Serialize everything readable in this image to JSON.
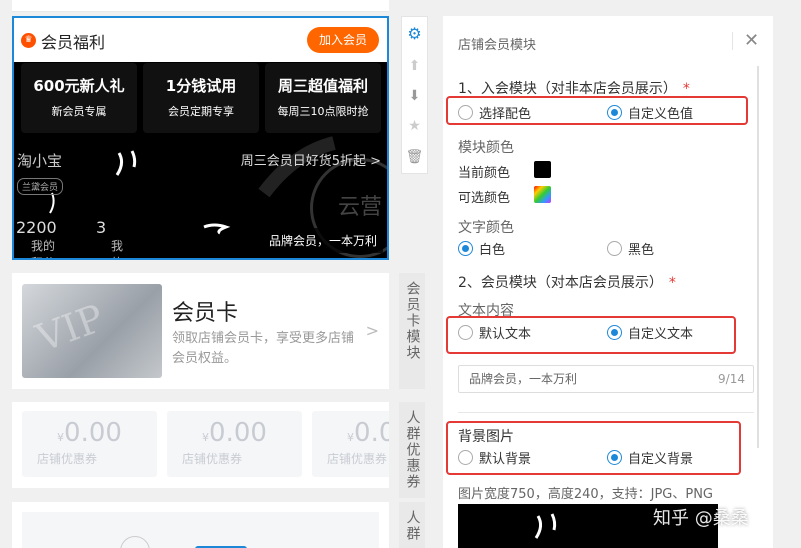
{
  "member_module": {
    "title": "会员福利",
    "join_button": "加入会员",
    "benefits": [
      {
        "title": "600元新人礼",
        "subtitle": "新会员专属"
      },
      {
        "title": "1分钱试用",
        "subtitle": "会员定期专享"
      },
      {
        "title": "周三超值福利",
        "subtitle": "每周三10点限时抢"
      }
    ],
    "user_name": "淘小宝",
    "user_badge": "兰黛会员",
    "promo_text": "周三会员日好货5折起 >",
    "seal_text": "云营",
    "points_value": "2200",
    "points_label": "我的积分",
    "coupons_value": "3",
    "coupons_label": "我的礼券",
    "brand_tag": "品牌会员，一本万利"
  },
  "vip_card": {
    "image_text": "VIP",
    "title": "会员卡",
    "description": "领取店铺会员卡，享受更多店铺会员权益。",
    "arrow": ">"
  },
  "coupons": [
    {
      "currency": "¥",
      "amount": "0.00",
      "label": "店铺优惠券"
    },
    {
      "currency": "¥",
      "amount": "0.00",
      "label": "店铺优惠券"
    },
    {
      "currency": "¥",
      "amount": "0.00",
      "label": "店铺优惠券"
    }
  ],
  "toolbar": {
    "icons": [
      "gear-icon",
      "arrow-up-icon",
      "arrow-down-icon",
      "star-icon",
      "trash-icon"
    ]
  },
  "side_tabs": [
    {
      "label": "会员卡模块"
    },
    {
      "label": "人群优惠券"
    },
    {
      "label": "人群"
    }
  ],
  "panel": {
    "title": "店铺会员模块",
    "close": "✕",
    "section1": {
      "label": "1、入会模块（对非本店会员展示）",
      "required": "*"
    },
    "color_mode": {
      "option_a": "选择配色",
      "option_b": "自定义色值",
      "selected": "option_b"
    },
    "module_color": {
      "label": "模块颜色",
      "current_label": "当前颜色",
      "current_color": "#000000",
      "optional_label": "可选颜色"
    },
    "text_color": {
      "label": "文字颜色",
      "option_a": "白色",
      "option_b": "黑色",
      "selected": "option_a"
    },
    "section2": {
      "label": "2、会员模块（对本店会员展示）",
      "required": "*"
    },
    "text_content": {
      "label": "文本内容",
      "option_a": "默认文本",
      "option_b": "自定义文本",
      "selected": "option_b"
    },
    "text_input": {
      "value": "品牌会员，一本万利",
      "counter": "9/14"
    },
    "background": {
      "label": "背景图片",
      "option_a": "默认背景",
      "option_b": "自定义背景",
      "selected": "option_b"
    },
    "image_hint": "图片宽度750，高度240，支持：JPG、PNG"
  },
  "watermark": "知乎 @桑桑",
  "colors": {
    "accent": "#1e88d8",
    "highlight": "#e53935",
    "brand_orange": "#ff6600"
  }
}
